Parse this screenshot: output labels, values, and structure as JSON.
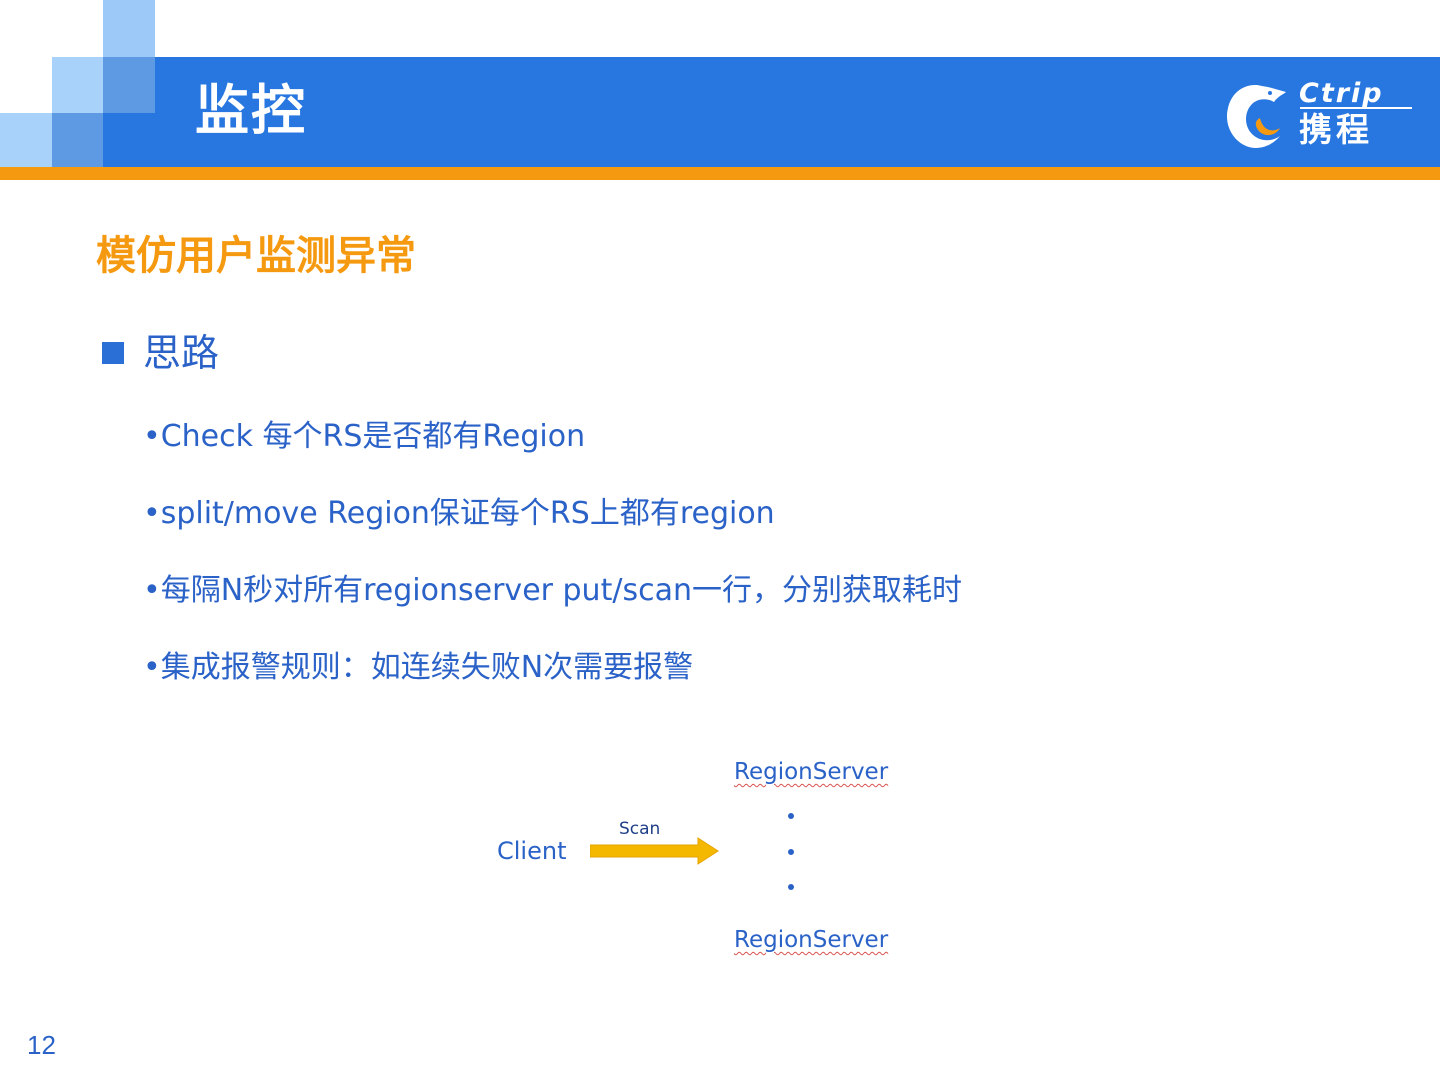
{
  "header": {
    "title": "监控",
    "logo": {
      "wordmark": "Ctrip",
      "chinese": "携程"
    }
  },
  "colors": {
    "header_blue": "#2877e0",
    "accent_orange": "#f59a10",
    "text_blue": "#2a62c8",
    "arrow_yellow": "#f5b800"
  },
  "slide": {
    "subtitle": "模仿用户监测异常",
    "section_heading": "思路",
    "bullets": [
      "•Check 每个RS是否都有Region",
      "•split/move Region保证每个RS上都有region",
      "•每隔N秒对所有regionserver put/scan一行，分别获取耗时",
      "•集成报警规则：如连续失败N次需要报警"
    ],
    "page_number": "12"
  },
  "diagram": {
    "client_label": "Client",
    "arrow_label": "Scan",
    "server_top": "RegionServer",
    "server_bottom": "RegionServer",
    "ellipsis_dots": 3
  }
}
